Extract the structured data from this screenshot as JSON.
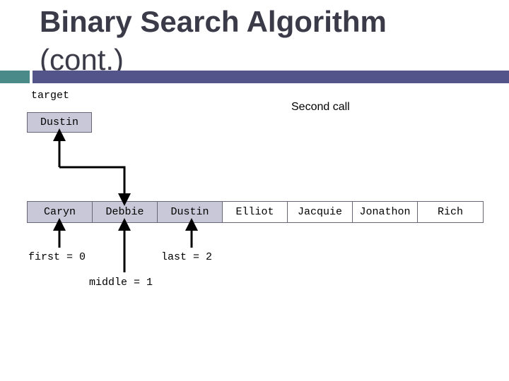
{
  "slide": {
    "title_line1": "Binary Search Algorithm",
    "title_line2": "(cont.)",
    "caption": "Second call",
    "accent_colors": {
      "teal": "#4a8a88",
      "purple": "#53548a",
      "cell_fill": "#c8c8d8"
    }
  },
  "target": {
    "label": "target",
    "value": "Dustin"
  },
  "array": {
    "cells": [
      {
        "value": "Caryn",
        "active": true
      },
      {
        "value": "Debbie",
        "active": true
      },
      {
        "value": "Dustin",
        "active": true
      },
      {
        "value": "Elliot",
        "active": false
      },
      {
        "value": "Jacquie",
        "active": false
      },
      {
        "value": "Jonathon",
        "active": false
      },
      {
        "value": "Rich",
        "active": false
      }
    ]
  },
  "pointers": {
    "first": "first = 0",
    "middle": "middle = 1",
    "last": "last = 2"
  }
}
